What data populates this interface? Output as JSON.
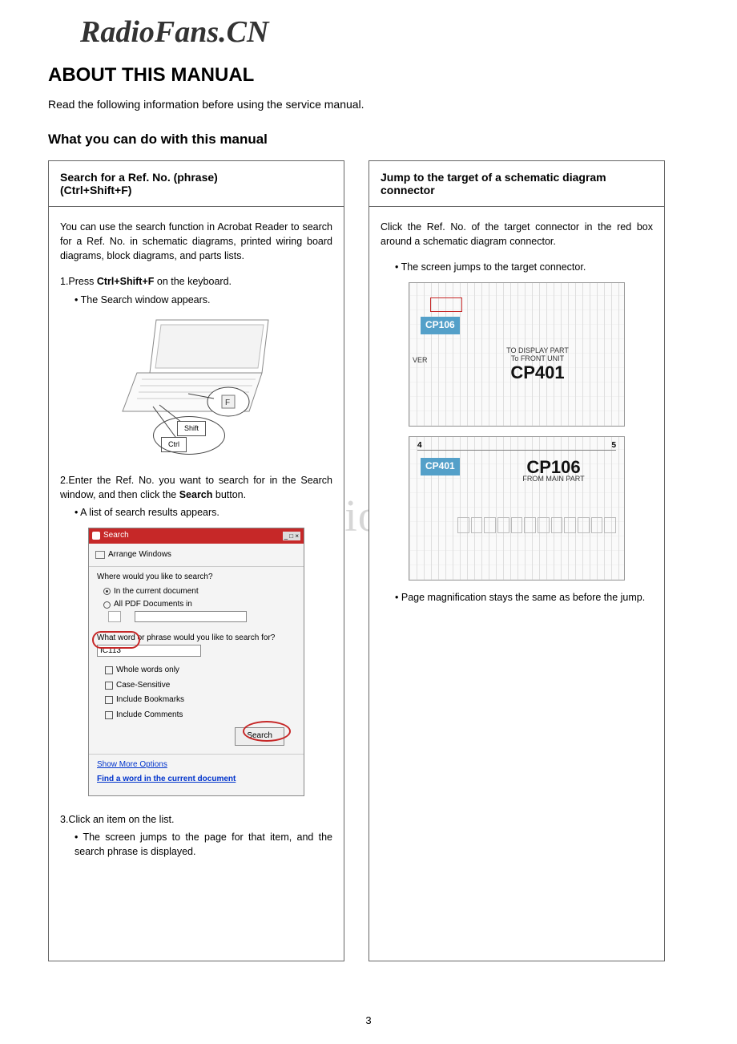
{
  "watermark_top": "RadioFans.CN",
  "watermark_mid": "www.radiofans.cn",
  "title": "ABOUT THIS MANUAL",
  "intro": "Read the following information before using the service manual.",
  "subtitle": "What you can do with this manual",
  "page_number": "3",
  "left": {
    "head_line1": "Search for a Ref. No. (phrase)",
    "head_line2": "(Ctrl+Shift+F)",
    "para1": "You can use the search function in Acrobat Reader to search for a Ref. No. in schematic diagrams, printed wiring board diagrams, block diagrams, and parts lists.",
    "step1_pre": "1.Press ",
    "step1_keys": "Ctrl+Shift+F",
    "step1_post": " on the keyboard.",
    "step1_b": "The Search window appears.",
    "key_shift": "Shift",
    "key_ctrl": "Ctrl",
    "step2_a": "2.Enter the Ref. No. you want to search for in the Search window, and then click the ",
    "step2_bold": "Search",
    "step2_b": " button.",
    "step2_bullet": "A list of search results appears.",
    "search": {
      "title": "Search",
      "close": "_ □ ×",
      "arrange": "Arrange Windows",
      "q1": "Where would you like to search?",
      "opt1": "In the current document",
      "opt2": "All PDF Documents in",
      "q2": "What word or phrase would you like to search for?",
      "input": "IC113",
      "c1": "Whole words only",
      "c2": "Case-Sensitive",
      "c3": "Include Bookmarks",
      "c4": "Include Comments",
      "btn": "Search",
      "link1": "Show More Options",
      "link2": "Find a word in the current document"
    },
    "step3": "3.Click an item on the list.",
    "step3_b": "The screen jumps to the page for that item, and the search phrase is displayed."
  },
  "right": {
    "head_line1": "Jump to the target of a schematic diagram",
    "head_line2": "connector",
    "para1": "Click the Ref. No. of the target connector in the red box around a schematic diagram connector.",
    "b1": "The screen jumps to the target connector.",
    "schem1": {
      "tag": "CP106",
      "sub_top": "TO DISPLAY PART",
      "sub_mid": "To FRONT UNIT",
      "big": "CP401",
      "ver": "VER"
    },
    "schem2": {
      "tag": "CP401",
      "big": "CP106",
      "sub": "FROM MAIN PART",
      "axis4": "4",
      "axis5": "5"
    },
    "b2": "Page magnification stays the same as before the jump."
  }
}
